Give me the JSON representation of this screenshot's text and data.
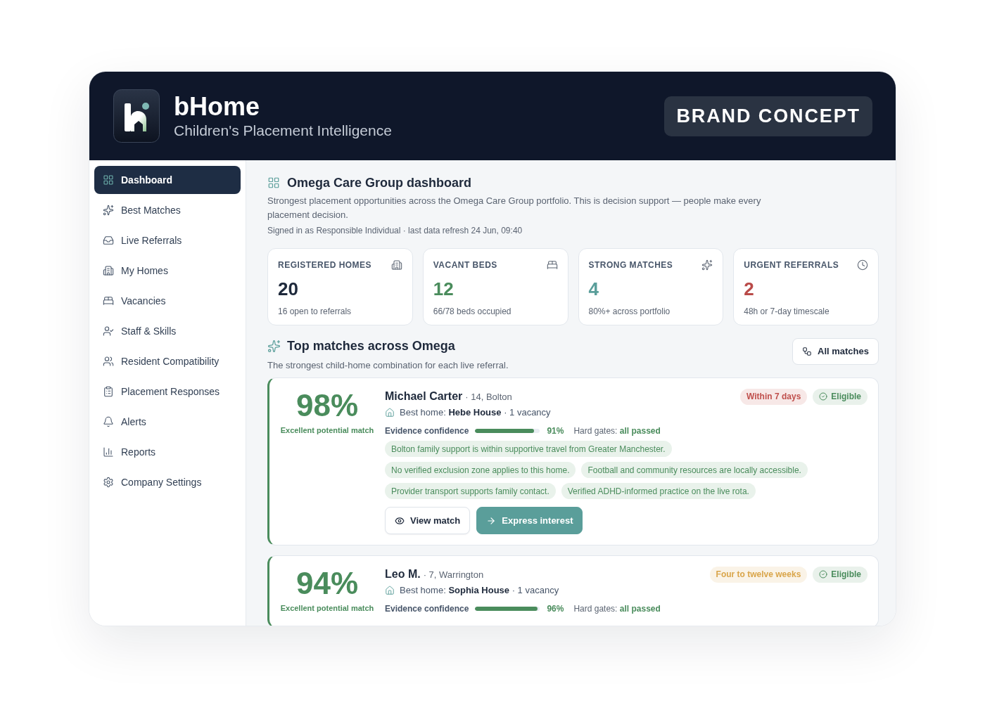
{
  "app": {
    "name": "bHome",
    "tagline": "Children's Placement Intelligence",
    "badge": "BRAND CONCEPT"
  },
  "sidebar": {
    "items": [
      {
        "label": "Dashboard",
        "selected": true
      },
      {
        "label": "Best Matches",
        "selected": false
      },
      {
        "label": "Live Referrals",
        "selected": false
      },
      {
        "label": "My Homes",
        "selected": false
      },
      {
        "label": "Vacancies",
        "selected": false
      },
      {
        "label": "Staff & Skills",
        "selected": false
      },
      {
        "label": "Resident Compatibility",
        "selected": false
      },
      {
        "label": "Placement Responses",
        "selected": false
      },
      {
        "label": "Alerts",
        "selected": false
      },
      {
        "label": "Reports",
        "selected": false
      },
      {
        "label": "Company Settings",
        "selected": false
      }
    ]
  },
  "page": {
    "title": "Omega Care Group dashboard",
    "description": "Strongest placement opportunities across the Omega Care Group portfolio. This is decision support — people make every placement decision.",
    "meta": "Signed in as Responsible Individual · last data refresh 24 Jun, 09:40"
  },
  "stats": [
    {
      "label": "REGISTERED HOMES",
      "value": "20",
      "note": "16 open to referrals",
      "color": "#1e293b"
    },
    {
      "label": "VACANT BEDS",
      "value": "12",
      "note": "66/78 beds occupied",
      "color": "#4a8c5c"
    },
    {
      "label": "STRONG MATCHES",
      "value": "4",
      "note": "80%+ across portfolio",
      "color": "#5a9e9a"
    },
    {
      "label": "URGENT REFERRALS",
      "value": "2",
      "note": "48h or 7-day timescale",
      "color": "#b94a48"
    }
  ],
  "matches_section": {
    "title": "Top matches across Omega",
    "subtitle": "The strongest child-home combination for each live referral.",
    "button": "All matches"
  },
  "matches": [
    {
      "score": "98%",
      "score_label": "Excellent potential match",
      "name": "Michael Carter",
      "details": "· 14, Bolton",
      "home": "Best home: **Hebe House** · 1 vacancy",
      "timescale": {
        "label": "Within 7 days",
        "color": "#c0504d"
      },
      "status": {
        "label": "Eligible",
        "color": "#4a8c5c"
      },
      "confidence_label": "Evidence confidence",
      "level": 0.91,
      "confidence": "91%",
      "gates": "Hard gates: **all passed**",
      "reasons": [
        "Bolton family support is within supportive travel from Greater Manchester.",
        "No verified exclusion zone applies to this home.",
        "Football and community resources are locally accessible.",
        "Provider transport supports family contact.",
        "Verified ADHD-informed practice on the live rota."
      ],
      "actions": [
        {
          "label": "View match",
          "kind": "secondary"
        },
        {
          "label": "Express interest",
          "kind": "primary"
        }
      ]
    },
    {
      "score": "94%",
      "score_label": "Excellent potential match",
      "name": "Leo M.",
      "details": "· 7, Warrington",
      "home": "Best home: **Sophia House** · 1 vacancy",
      "timescale": {
        "label": "Four to twelve weeks",
        "color": "#d9a54a"
      },
      "status": {
        "label": "Eligible",
        "color": "#4a8c5c"
      },
      "confidence_label": "Evidence confidence",
      "level": 0.96,
      "confidence": "96%",
      "gates": "Hard gates: **all passed**"
    }
  ]
}
